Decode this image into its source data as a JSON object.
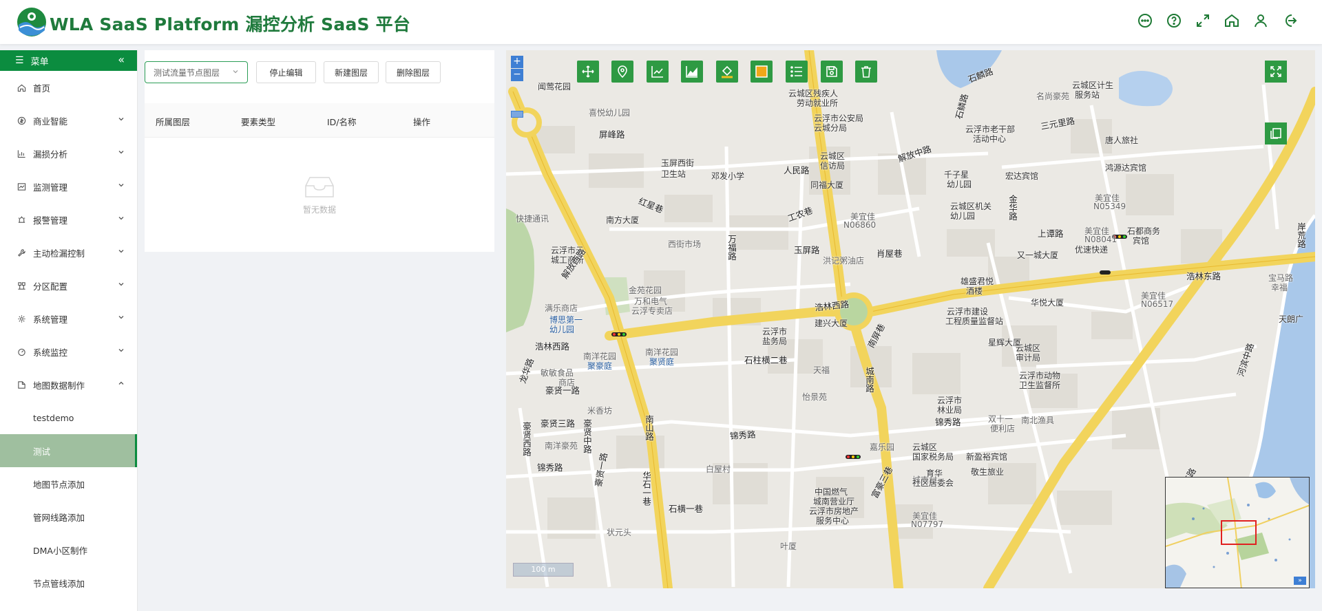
{
  "header": {
    "brand": "WLA SaaS Platform 漏控分析 SaaS 平台",
    "icons": [
      "message-icon",
      "help-icon",
      "fullscreen-icon",
      "home-icon",
      "user-icon",
      "logout-icon"
    ]
  },
  "sidebar": {
    "menu_label": "菜单",
    "items": [
      {
        "label": "首页",
        "icon": "home-icon",
        "expandable": false
      },
      {
        "label": "商业智能",
        "icon": "coin-icon",
        "expandable": true
      },
      {
        "label": "漏损分析",
        "icon": "bar-chart-icon",
        "expandable": true
      },
      {
        "label": "监测管理",
        "icon": "line-chart-icon",
        "expandable": true
      },
      {
        "label": "报警管理",
        "icon": "alarm-icon",
        "expandable": true
      },
      {
        "label": "主动检漏控制",
        "icon": "wrench-icon",
        "expandable": true
      },
      {
        "label": "分区配置",
        "icon": "partition-icon",
        "expandable": true
      },
      {
        "label": "系统管理",
        "icon": "gear-icon",
        "expandable": true
      },
      {
        "label": "系统监控",
        "icon": "monitor-icon",
        "expandable": true
      },
      {
        "label": "地图数据制作",
        "icon": "map-icon",
        "expandable": true,
        "open": true
      }
    ],
    "sub_items": [
      {
        "label": "testdemo",
        "active": false
      },
      {
        "label": "测试",
        "active": true
      },
      {
        "label": "地图节点添加",
        "active": false
      },
      {
        "label": "管网线路添加",
        "active": false
      },
      {
        "label": "DMA小区制作",
        "active": false
      },
      {
        "label": "节点管线添加",
        "active": false
      }
    ]
  },
  "panel": {
    "layer_select": "测试流量节点图层",
    "buttons": {
      "stop_edit": "停止编辑",
      "new_layer": "新建图层",
      "delete_layer": "删除图层"
    },
    "columns": [
      "所属图层",
      "要素类型",
      "ID/名称",
      "操作"
    ],
    "empty_text": "暂无数据"
  },
  "map": {
    "tools": [
      "pan-icon",
      "location-pin-icon",
      "line-chart-icon",
      "area-chart-icon",
      "paint-bucket-icon",
      "square-icon",
      "list-icon",
      "save-icon",
      "trash-icon"
    ],
    "scale_text": "100 m",
    "labels": {
      "l1": "屏峰路",
      "l2": "闻莺花园",
      "l3": "喜悦幼儿园",
      "l4": "玉屏西街",
      "l5": "卫生站",
      "l6": "邓发小学",
      "l7": "人民路",
      "l8": "红星巷",
      "l9": "南方大厦",
      "l10": "云浮市云",
      "l11": "城工商所",
      "l12": "西街市场",
      "l13": "工农巷",
      "l14": "同福大厦",
      "l15": "美宜佳",
      "l16": "N06860",
      "l17": "玉屏路",
      "l18": "洪记粥油店",
      "l19": "云城区残疾人",
      "l20": "劳动就业所",
      "l21": "云浮市公安局",
      "l22": "云城分局",
      "l23": "云城区",
      "l24": "信访局",
      "l25": "解放中路",
      "l26": "千子星",
      "l27": "幼儿园",
      "l28": "宏达宾馆",
      "l29": "云城区机关",
      "l30": "幼儿园",
      "l31": "金华路",
      "l32": "上谭路",
      "l33": "美宜佳",
      "l34": "N08041",
      "l35": "石都商务",
      "l36": "宾馆",
      "l37": "又一城大厦",
      "l38": "优速快递",
      "l39": "肖屋巷",
      "l40": "雄盛君悦",
      "l41": "酒楼",
      "l42": "华悦大厦",
      "l43": "云浮市建设",
      "l44": "工程质量监督站",
      "l45": "浩林东路",
      "l46": "浩林西路",
      "l47": "万福路",
      "l48": "金苑花园",
      "l49": "万和电气",
      "l50": "云浮专卖店",
      "l51": "解放西路",
      "l52": "满乐商店",
      "l53": "博思第一",
      "l54": "幼儿园",
      "l55": "浩林西路",
      "l56": "建兴大厦",
      "l57": "云浮市",
      "l58": "盐务局",
      "l59": "石柱横二巷",
      "l60": "南洋花园",
      "l61": "聚豪庭",
      "l62": "南洋花园",
      "l63": "聚贤庭",
      "l64": "城南路",
      "l65": "天福",
      "l66": "怡景苑",
      "l67": "南屏巷",
      "l68": "星辉大厦",
      "l69": "云城区",
      "l70": "审计局",
      "l71": "云浮市动物",
      "l72": "卫生监督所",
      "l73": "云浮市",
      "l74": "林业局",
      "l75": "锦秀路",
      "l76": "双十一",
      "l77": "便利店",
      "l78": "南北渔具",
      "l79": "豪贤一路",
      "l80": "豪贤三路",
      "l81": "豪贤中路",
      "l82": "米香坊",
      "l83": "南洋豪苑",
      "l84": "南山路",
      "l85": "锦秀路",
      "l86": "锦秀路",
      "l87": "白屋村",
      "l88": "云城区",
      "l89": "国家税务局",
      "l90": "新盈裕宾馆",
      "l91": "嘉乐园",
      "l92": "城南村",
      "l93": "育华",
      "l94": "社区居委会",
      "l95": "敬生旅业",
      "l96": "华石一巷",
      "l97": "石横一巷",
      "l98": "中国燃气",
      "l99": "城南营业厅",
      "l100": "云浮市房地产",
      "l101": "服务中心",
      "l102": "富豪三巷",
      "l103": "美宜佳",
      "l104": "N07797",
      "l105": "叶厦",
      "l106": "状元头",
      "l107": "石麟路",
      "l108": "云城区计生",
      "l109": "服务站",
      "l110": "名尚豪苑",
      "l111": "云浮市老干部",
      "l112": "活动中心",
      "l113": "三元里路",
      "l114": "唐人旅社",
      "l115": "鸿源达宾馆",
      "l116": "美宜佳",
      "l117": "N05349",
      "l118": "美宜佳",
      "l119": "N06517",
      "l120": "天朗广",
      "l121": "河滨中路",
      "l122": "河滨东路",
      "l123": "宝马路",
      "l124": "幸福",
      "l125": "豪贤西路",
      "l126": "豪贤一路",
      "l127": "龙华路",
      "l128": "快捷通讯",
      "l129": "敏敏食品",
      "l130": "商店",
      "l131": "石鳞路",
      "l132": "岸荒路"
    }
  }
}
